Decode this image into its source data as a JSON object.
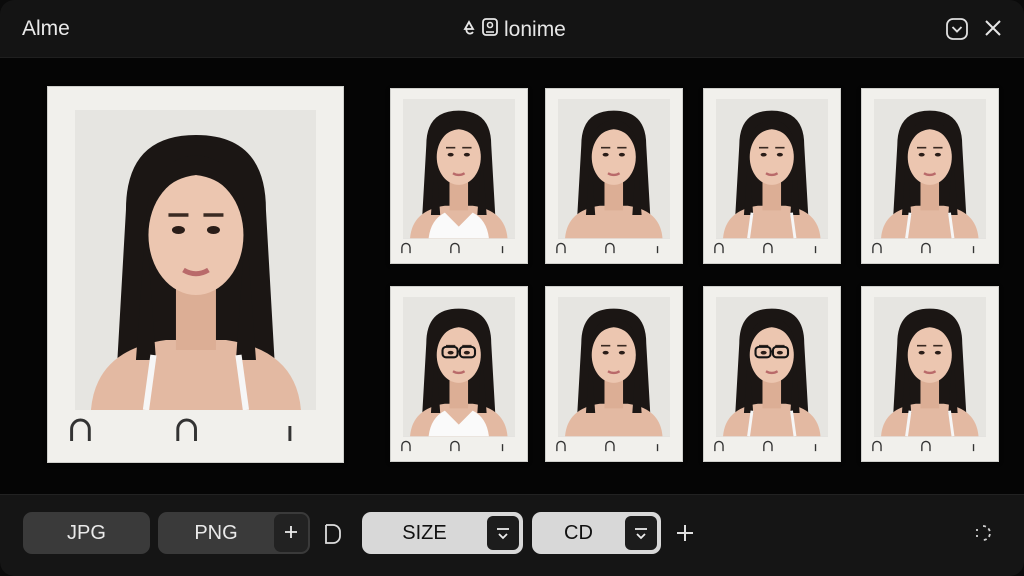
{
  "window": {
    "app_name": "Alme",
    "title": "lonime"
  },
  "photos": {
    "main": {
      "label": "main-portrait"
    },
    "grid": [
      {
        "variant": "white-collar"
      },
      {
        "variant": "bare-shoulders"
      },
      {
        "variant": "tank-top"
      },
      {
        "variant": "tank-top"
      },
      {
        "variant": "glasses-white-collar"
      },
      {
        "variant": "bare-shoulders"
      },
      {
        "variant": "glasses-tank-top"
      },
      {
        "variant": "tank-top-smile"
      }
    ]
  },
  "toolbar": {
    "jpg_label": "JPG",
    "png_label": "PNG",
    "size_label": "SIZE",
    "cd_label": "CD"
  },
  "colors": {
    "background": "#050505",
    "bar": "#151515",
    "pill_dark": "#3a3a3a",
    "pill_light": "#d8d8d8",
    "paper": "#f1f0ec"
  },
  "icons": [
    "app-logo-icon",
    "minimize-icon",
    "close-icon",
    "plus-icon",
    "crop-icon",
    "caret-down-icon",
    "refresh-icon"
  ]
}
